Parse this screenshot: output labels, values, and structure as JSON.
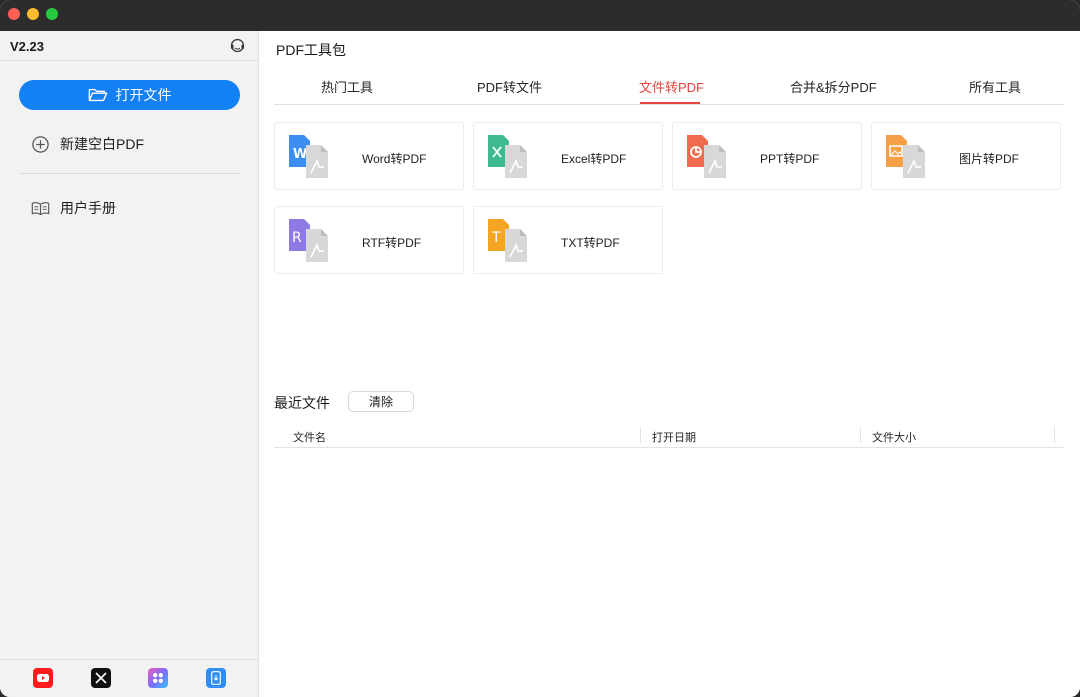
{
  "sidebar": {
    "version": "V2.23",
    "open_button": "打开文件",
    "items": [
      {
        "label": "新建空白PDF",
        "icon": "plus-circle-icon"
      },
      {
        "label": "用户手册",
        "icon": "book-icon"
      }
    ],
    "social": [
      {
        "name": "youtube-icon"
      },
      {
        "name": "x-icon"
      },
      {
        "name": "apps-icon"
      },
      {
        "name": "download-app-icon"
      }
    ]
  },
  "main": {
    "title": "PDF工具包",
    "tabs": [
      {
        "label": "热门工具"
      },
      {
        "label": "PDF转文件"
      },
      {
        "label": "文件转PDF",
        "active": true
      },
      {
        "label": "合并&拆分PDF"
      },
      {
        "label": "所有工具"
      }
    ],
    "tools": [
      {
        "label": "Word转PDF",
        "icon": "word-to-pdf-icon",
        "color": "#3c8ff0",
        "glyph": "W"
      },
      {
        "label": "Excel转PDF",
        "icon": "excel-to-pdf-icon",
        "color": "#3fba8f",
        "glyph": "×"
      },
      {
        "label": "PPT转PDF",
        "icon": "ppt-to-pdf-icon",
        "color": "#f06b4f",
        "glyph": "◔"
      },
      {
        "label": "图片转PDF",
        "icon": "image-to-pdf-icon",
        "color": "#f5a047",
        "glyph": "▭"
      },
      {
        "label": "RTF转PDF",
        "icon": "rtf-to-pdf-icon",
        "color": "#8f7ae5",
        "glyph": "R"
      },
      {
        "label": "TXT转PDF",
        "icon": "txt-to-pdf-icon",
        "color": "#f5a524",
        "glyph": "T"
      }
    ],
    "recent": {
      "title": "最近文件",
      "clear_label": "清除",
      "columns": [
        "文件名",
        "打开日期",
        "文件大小"
      ]
    }
  },
  "colors": {
    "accent": "#1380f3",
    "active_tab": "#e5443f"
  }
}
